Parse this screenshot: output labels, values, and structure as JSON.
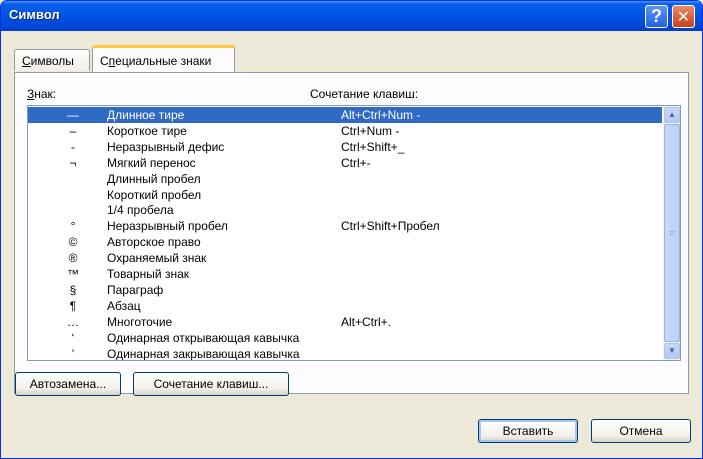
{
  "window": {
    "title": "Символ",
    "help_glyph": "?",
    "close_glyph": "✕"
  },
  "tabs": [
    {
      "label": "Символы",
      "accel": "С",
      "rest": "имволы",
      "active": false
    },
    {
      "label": "Специальные знаки",
      "accel": "п",
      "prefix": "С",
      "rest": "ециальные знаки",
      "active": true
    }
  ],
  "list_header": {
    "sign_label": "Знак:",
    "sign_accel": "З",
    "sign_rest": "нак:",
    "shortcut_label": "Сочетание клавиш:"
  },
  "items": [
    {
      "symbol": "—",
      "name": "Длинное тире",
      "shortcut": "Alt+Ctrl+Num -",
      "selected": true
    },
    {
      "symbol": "–",
      "name": "Короткое тире",
      "shortcut": "Ctrl+Num -"
    },
    {
      "symbol": "-",
      "name": "Неразрывный дефис",
      "shortcut": "Ctrl+Shift+_"
    },
    {
      "symbol": "¬",
      "name": "Мягкий перенос",
      "shortcut": "Ctrl+-"
    },
    {
      "symbol": "",
      "name": "Длинный пробел",
      "shortcut": ""
    },
    {
      "symbol": "",
      "name": "Короткий пробел",
      "shortcut": ""
    },
    {
      "symbol": "",
      "name": "1/4 пробела",
      "shortcut": ""
    },
    {
      "symbol": "°",
      "name": "Неразрывный пробел",
      "shortcut": "Ctrl+Shift+Пробел"
    },
    {
      "symbol": "©",
      "name": "Авторское право",
      "shortcut": ""
    },
    {
      "symbol": "®",
      "name": "Охраняемый знак",
      "shortcut": ""
    },
    {
      "symbol": "™",
      "name": "Товарный знак",
      "shortcut": ""
    },
    {
      "symbol": "§",
      "name": "Параграф",
      "shortcut": ""
    },
    {
      "symbol": "¶",
      "name": "Абзац",
      "shortcut": ""
    },
    {
      "symbol": "…",
      "name": "Многоточие",
      "shortcut": "Alt+Ctrl+."
    },
    {
      "symbol": "‘",
      "name": "Одинарная открывающая кавычка",
      "shortcut": ""
    },
    {
      "symbol": "’",
      "name": "Одинарная закрывающая кавычка",
      "shortcut": ""
    }
  ],
  "scrollbar": {
    "up_glyph": "▲",
    "down_glyph": "▼",
    "grip_glyph": "≡"
  },
  "buttons": {
    "autocorrect": "Автозамена...",
    "shortcut": "Сочетание клавиш...",
    "insert": "Вставить",
    "cancel": "Отмена"
  },
  "colors": {
    "selection": "#316ac5",
    "titlebar": "#0055e5",
    "tab_highlight": "#ffc83c"
  }
}
